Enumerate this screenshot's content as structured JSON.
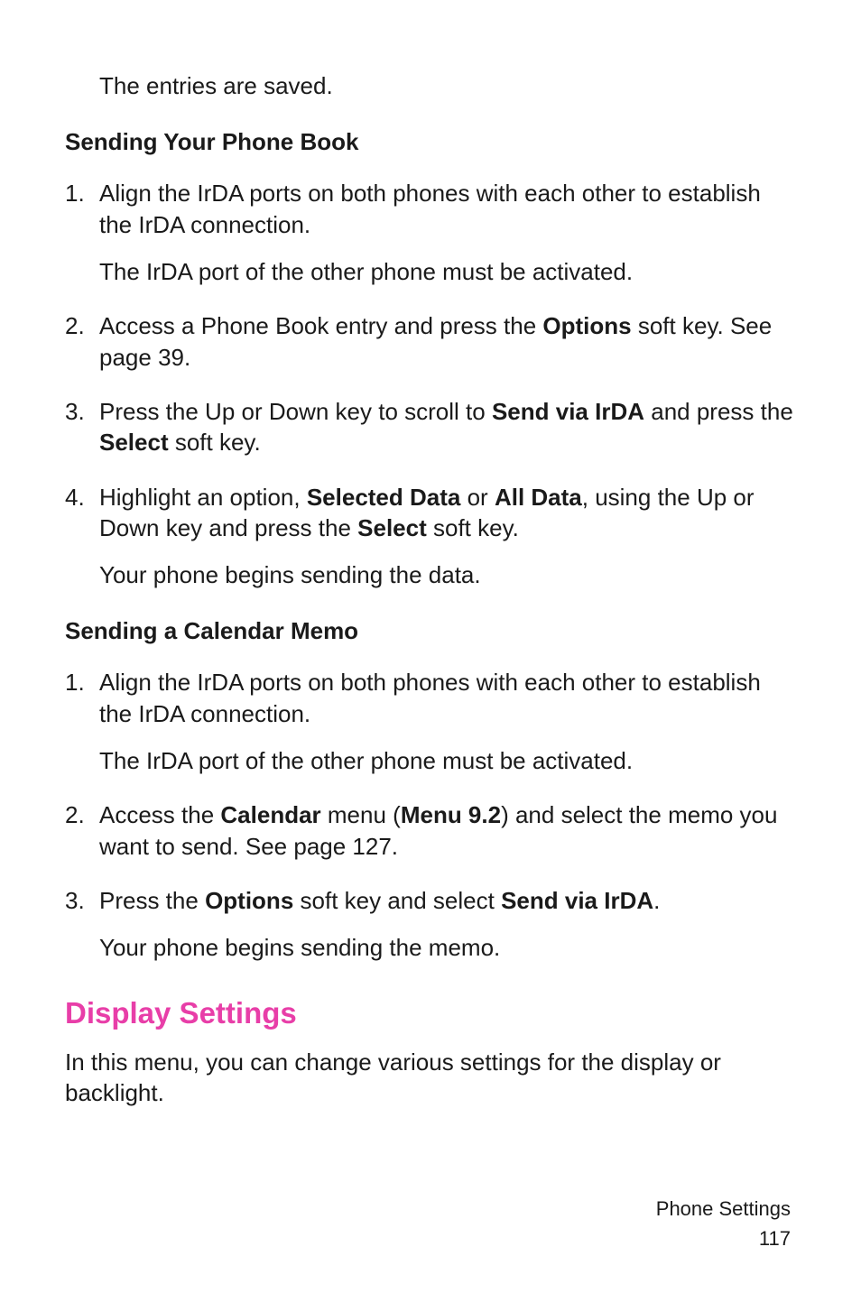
{
  "intro": "The entries are saved.",
  "section1": {
    "heading": "Sending Your Phone Book",
    "items": [
      {
        "num": "1.",
        "text_parts": [
          [
            "Align the IrDA ports on both phones with each other to establish the IrDA connection.",
            false
          ]
        ],
        "follow": "The IrDA port of the other phone must be activated."
      },
      {
        "num": "2.",
        "text_parts": [
          [
            "Access a Phone Book entry and press the ",
            false
          ],
          [
            "Options",
            true
          ],
          [
            " soft key. See page 39.",
            false
          ]
        ]
      },
      {
        "num": "3.",
        "text_parts": [
          [
            "Press the Up or Down key to scroll to ",
            false
          ],
          [
            "Send via IrDA",
            true
          ],
          [
            " and press the ",
            false
          ],
          [
            "Select",
            true
          ],
          [
            " soft key.",
            false
          ]
        ]
      },
      {
        "num": "4.",
        "text_parts": [
          [
            "Highlight an option, ",
            false
          ],
          [
            "Selected Data",
            true
          ],
          [
            " or ",
            false
          ],
          [
            "All Data",
            true
          ],
          [
            ", using the Up or Down key and press the ",
            false
          ],
          [
            "Select",
            true
          ],
          [
            " soft key.",
            false
          ]
        ],
        "follow": "Your phone begins sending the data."
      }
    ]
  },
  "section2": {
    "heading": "Sending a Calendar Memo",
    "items": [
      {
        "num": "1.",
        "text_parts": [
          [
            "Align the IrDA ports on both phones with each other to establish the IrDA connection.",
            false
          ]
        ],
        "follow": "The IrDA port of the other phone must be activated."
      },
      {
        "num": "2.",
        "text_parts": [
          [
            "Access the ",
            false
          ],
          [
            "Calendar",
            true
          ],
          [
            " menu (",
            false
          ],
          [
            "Menu 9.2",
            true
          ],
          [
            ") and select the memo you want to send. See page 127.",
            false
          ]
        ]
      },
      {
        "num": "3.",
        "text_parts": [
          [
            "Press the ",
            false
          ],
          [
            "Options",
            true
          ],
          [
            " soft key and select ",
            false
          ],
          [
            "Send via IrDA",
            true
          ],
          [
            ".",
            false
          ]
        ],
        "follow": "Your phone begins sending the memo."
      }
    ]
  },
  "section3": {
    "heading": "Display Settings",
    "text": "In this menu, you can change various settings for the display or backlight."
  },
  "footer": {
    "label": "Phone Settings",
    "page": "117"
  }
}
